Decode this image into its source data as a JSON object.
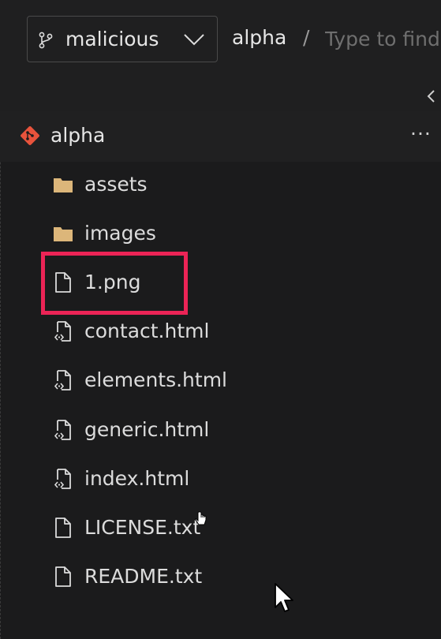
{
  "topbar": {
    "branch_label": "malicious",
    "breadcrumb_repo": "alpha",
    "breadcrumb_separator": "/",
    "path_placeholder": "Type to find"
  },
  "tree": {
    "repo_label": "alpha",
    "more_icon": "···",
    "items": [
      {
        "label": "assets",
        "kind": "folder"
      },
      {
        "label": "images",
        "kind": "folder"
      },
      {
        "label": "1.png",
        "kind": "file"
      },
      {
        "label": "contact.html",
        "kind": "html"
      },
      {
        "label": "elements.html",
        "kind": "html"
      },
      {
        "label": "generic.html",
        "kind": "html"
      },
      {
        "label": "index.html",
        "kind": "html"
      },
      {
        "label": "LICENSE.txt",
        "kind": "file"
      },
      {
        "label": "README.txt",
        "kind": "file"
      }
    ]
  },
  "colors": {
    "background": "#1b1b1c",
    "folder": "#dcb67a",
    "repo_accent": "#e8533c",
    "highlight": "#ec2456"
  },
  "icons": {
    "branch": "git-branch-icon",
    "dropdown": "chevron-down-icon",
    "collapse": "chevron-left-icon",
    "repo": "git-repo-icon",
    "folder": "folder-icon",
    "file": "file-icon",
    "html": "file-code-icon"
  }
}
